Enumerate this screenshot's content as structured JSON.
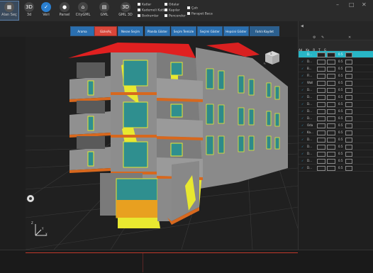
{
  "ribbon": {
    "buttons": [
      {
        "label": "Alan Seç",
        "icon": "select-area-icon",
        "color": "#555"
      },
      {
        "label": "3d",
        "icon": "3d-icon",
        "color": "#444"
      },
      {
        "label": "Veri",
        "icon": "check-circle-icon",
        "color": "#2a7fd0"
      },
      {
        "label": "Parsel",
        "icon": "pin-icon",
        "color": "#444"
      },
      {
        "label": "CityGML",
        "icon": "map-icon",
        "color": "#444"
      },
      {
        "label": "GML",
        "icon": "grid-icon",
        "color": "#444"
      },
      {
        "label": "GML 3D",
        "icon": "3d-icon",
        "color": "#444"
      }
    ],
    "checks_col1": [
      "Katlar",
      "Kademeli Katlar",
      "Bodrumlar"
    ],
    "checks_col2": [
      "Odalar",
      "Kapılar",
      "Pencereler"
    ],
    "checks_col3": [
      "Çatı",
      "Parapet Baca"
    ],
    "window_controls": [
      "–",
      "□",
      "✕"
    ]
  },
  "toolbar": {
    "buttons": [
      {
        "label": "Arama",
        "style": "blue"
      },
      {
        "label": "Gizle/Aç",
        "style": "red"
      },
      {
        "label": "Nesne Seçim",
        "style": "blue"
      },
      {
        "label": "Planda Göster",
        "style": "blue"
      },
      {
        "label": "Seçim Temizle",
        "style": "blue"
      },
      {
        "label": "Seçimi Göster",
        "style": "blue"
      },
      {
        "label": "Hepsini Göster",
        "style": "blue"
      },
      {
        "label": "Farklı Kaydet",
        "style": "dark"
      }
    ]
  },
  "layers": {
    "headers": [
      "",
      "Ad",
      "Ka",
      "R",
      "T",
      "G"
    ],
    "rows": [
      {
        "name": "D...",
        "value": "0.5",
        "selected": true
      },
      {
        "name": "D...",
        "value": "0.5",
        "selected": false
      },
      {
        "name": "B...",
        "value": "0.5",
        "selected": false
      },
      {
        "name": "Fl...",
        "value": "0.5",
        "selected": false
      },
      {
        "name": "Wall",
        "value": "0.5",
        "selected": false
      },
      {
        "name": "D...",
        "value": "0.5",
        "selected": false
      },
      {
        "name": "D...",
        "value": "0.5",
        "selected": false
      },
      {
        "name": "D...",
        "value": "0.5",
        "selected": false
      },
      {
        "name": "D...",
        "value": "0.5",
        "selected": false
      },
      {
        "name": "D...",
        "value": "0.5",
        "selected": false
      },
      {
        "name": "Oda",
        "value": "0.5",
        "selected": false
      },
      {
        "name": "Ka...",
        "value": "0.5",
        "selected": false
      },
      {
        "name": "D...",
        "value": "0.5",
        "selected": false
      },
      {
        "name": "D...",
        "value": "0.5",
        "selected": false
      },
      {
        "name": "D...",
        "value": "0.5",
        "selected": false
      },
      {
        "name": "D...",
        "value": "0.5",
        "selected": false
      },
      {
        "name": "D...",
        "value": "0.5",
        "selected": false
      }
    ]
  },
  "viewport": {
    "nav_cube_label": "S",
    "axis_labels": [
      "Z",
      "Y",
      "X"
    ]
  },
  "colors": {
    "accent": "#2a6fb0",
    "highlight_red": "#d9463a",
    "selected_row": "#28b6c6",
    "roof": "#e02020",
    "wall_yellow": "#e8e830",
    "slab_orange": "#d7681e"
  }
}
